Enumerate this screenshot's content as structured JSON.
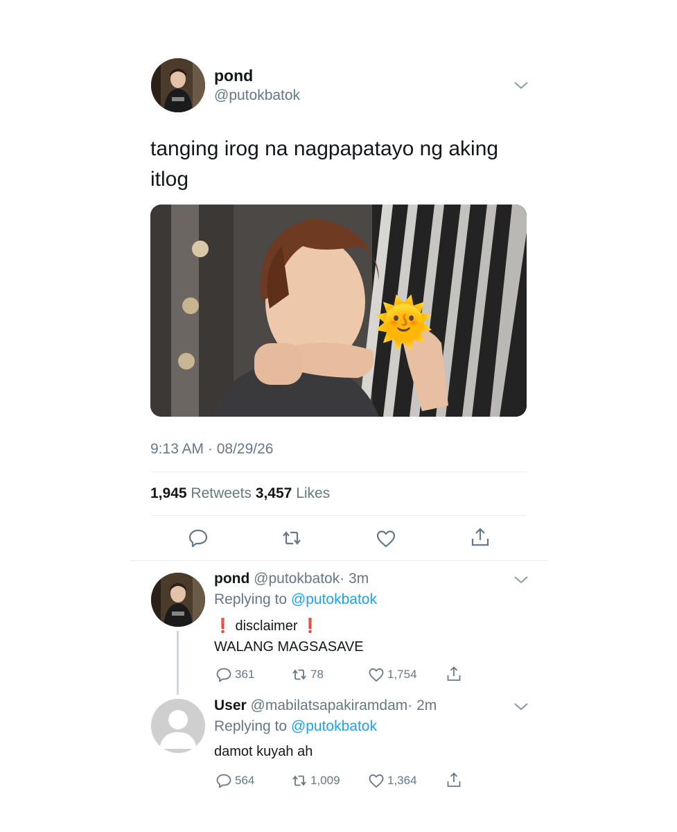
{
  "main_tweet": {
    "display_name": "pond",
    "handle": "@putokbatok",
    "text": "tanging irog na nagpapatayo ng aking itlog",
    "timestamp": "9:13 AM · 08/29/26",
    "retweets_count": "1,945",
    "retweets_label": "Retweets",
    "likes_count": "3,457",
    "likes_label": "Likes",
    "emoji": "🌞"
  },
  "replies": [
    {
      "display_name": "pond",
      "handle": "@putokbatok",
      "time": "· 3m",
      "replying_to_label": "Replying to",
      "replying_to_handle": "@putokbatok",
      "line1": "❗ disclaimer ❗",
      "line2": "WALANG MAGSASAVE",
      "replies_count": "361",
      "retweets_count": "78",
      "likes_count": "1,754"
    },
    {
      "display_name": "User",
      "handle": "@mabilatsapakiramdam",
      "time": "· 2m",
      "replying_to_label": "Replying to",
      "replying_to_handle": "@putokbatok",
      "line1": "damot kuyah ah",
      "replies_count": "564",
      "retweets_count": "1,009",
      "likes_count": "1,364"
    }
  ],
  "colors": {
    "text": "#14171a",
    "muted": "#657786",
    "link": "#1da1f2",
    "divider": "#e6ecf0"
  }
}
